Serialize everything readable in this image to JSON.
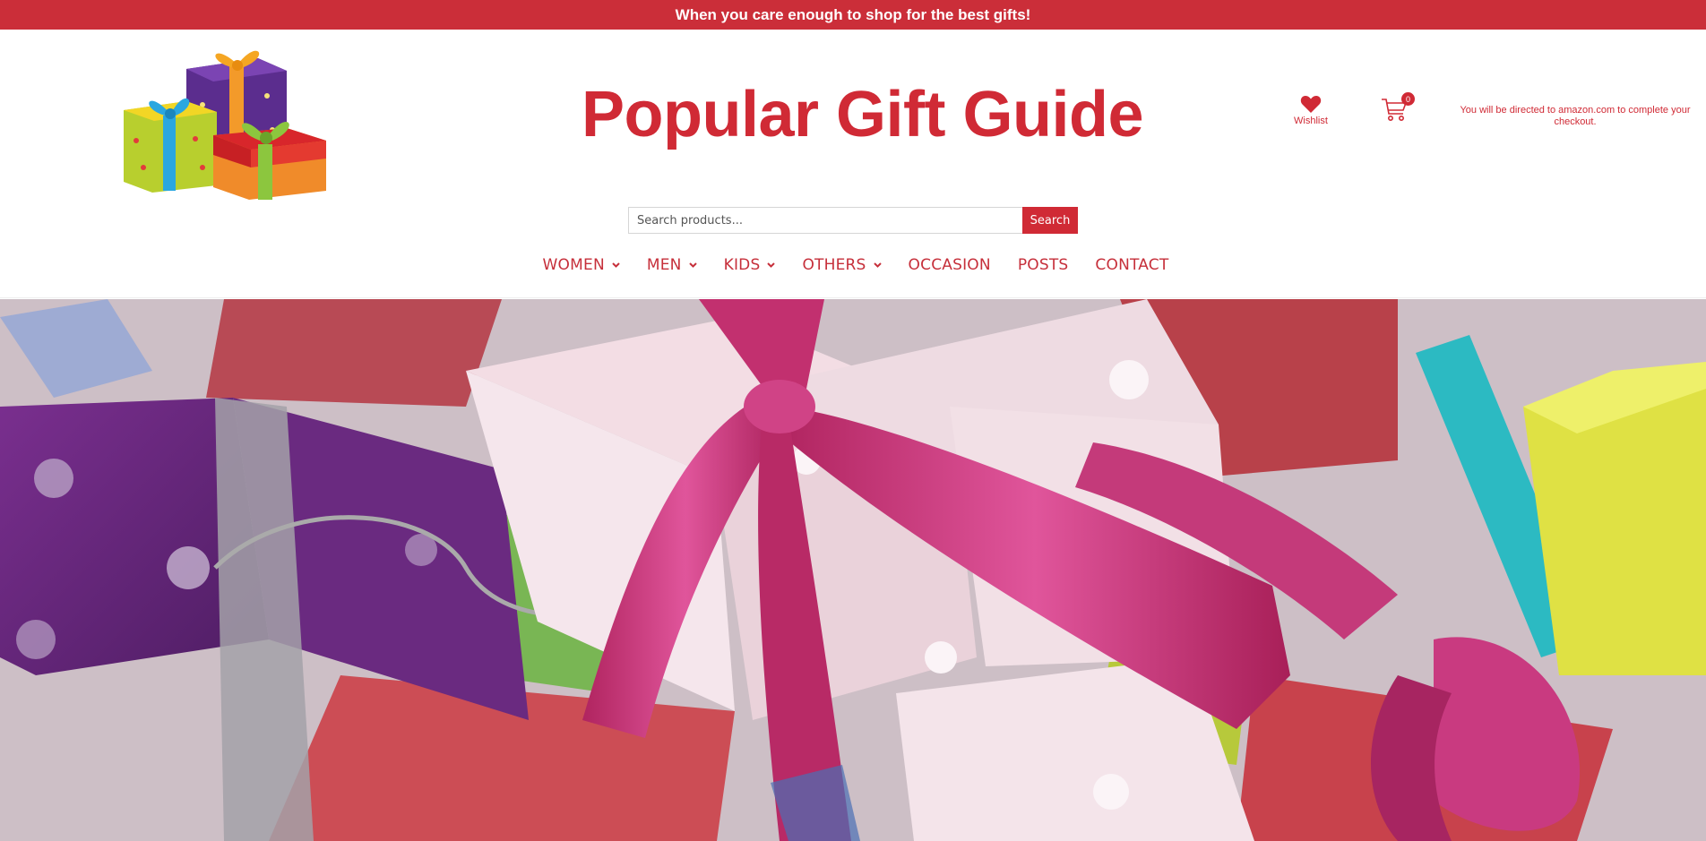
{
  "topbar": {
    "text": "When you care enough to shop for the best gifts!"
  },
  "header": {
    "title": "Popular Gift Guide",
    "wishlist_label": "Wishlist",
    "cart_count": "0",
    "checkout_note": "You will be directed to amazon.com to complete your checkout."
  },
  "search": {
    "placeholder": "Search products...",
    "button_label": "Search"
  },
  "nav": {
    "items": [
      {
        "label": "WOMEN",
        "has_dropdown": true
      },
      {
        "label": "MEN",
        "has_dropdown": true
      },
      {
        "label": "KIDS",
        "has_dropdown": true
      },
      {
        "label": "OTHERS",
        "has_dropdown": true
      },
      {
        "label": "OCCASION",
        "has_dropdown": false
      },
      {
        "label": "POSTS",
        "has_dropdown": false
      },
      {
        "label": "CONTACT",
        "has_dropdown": false
      }
    ]
  },
  "icons": {
    "logo": "gift-boxes-logo",
    "wishlist": "heart-icon",
    "cart": "shopping-cart-icon",
    "dropdown": "chevron-down-icon",
    "hero": "wrapped-gifts-hero-image"
  },
  "colors": {
    "brand_red": "#d02a35",
    "topbar_red": "#cb2e39",
    "background": "#ffffff"
  }
}
